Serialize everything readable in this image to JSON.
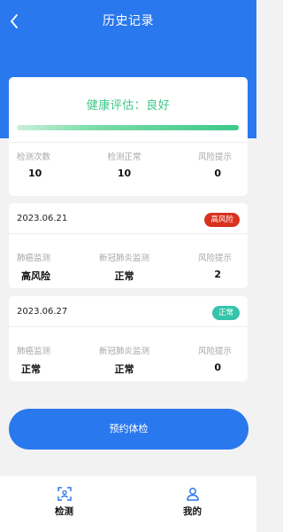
{
  "header": {
    "title": "历史记录",
    "back_icon": "chevron-left-icon"
  },
  "colors": {
    "primary": "#2a78ee",
    "good": "#3cc88a",
    "high_risk": "#d8321f",
    "normal": "#33c4a9"
  },
  "summary": {
    "assessment": "健康评估：良好",
    "progress_fraction": 1.0,
    "stats": [
      {
        "label": "检测次数",
        "value": "10"
      },
      {
        "label": "检测正常",
        "value": "10"
      },
      {
        "label": "风险提示",
        "value": "0"
      }
    ]
  },
  "records": [
    {
      "date": "2023.06.21",
      "badge": "高风险",
      "stats": [
        {
          "label": "肺癌监测",
          "value": "高风险"
        },
        {
          "label": "新冠肺炎监测",
          "value": "正常"
        },
        {
          "label": "风险提示",
          "value": "2"
        }
      ]
    },
    {
      "date": "2023.06.27",
      "badge": "正常",
      "stats": [
        {
          "label": "肺癌监测",
          "value": "正常"
        },
        {
          "label": "新冠肺炎监测",
          "value": "正常"
        },
        {
          "label": "风险提示",
          "value": "0"
        }
      ]
    }
  ],
  "book_button": "预约体检",
  "tabbar": [
    {
      "label": "检测",
      "icon": "scan-icon"
    },
    {
      "label": "我的",
      "icon": "user-icon"
    }
  ]
}
